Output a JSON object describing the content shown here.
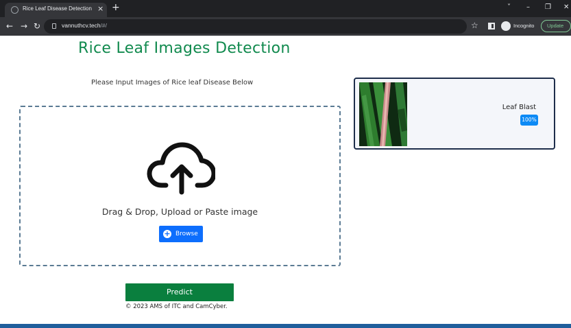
{
  "browser": {
    "tab_title": "Rice Leaf Disease Detection",
    "tab_close": "×",
    "new_tab": "+",
    "url_host": "vannuthcv.tech",
    "url_path": "/#/",
    "incognito_label": "Incognito",
    "update_label": "Update",
    "window_controls": [
      "˅",
      "–",
      "❐",
      "✕"
    ]
  },
  "page": {
    "title": "Rice Leaf Images Detection",
    "instruction": "Please Input Images of Rice leaf Disease Below"
  },
  "dropzone": {
    "text": "Drag & Drop, Upload or Paste image",
    "browse_label": "Browse",
    "icon": "cloud-upload-icon"
  },
  "result": {
    "label": "Leaf Blast",
    "confidence": "100%"
  },
  "actions": {
    "predict_label": "Predict"
  },
  "footer": {
    "text": "© 2023 AMS of ITC and CamCyber."
  },
  "colors": {
    "title_green": "#118a4e",
    "predict_green": "#0a7f3e",
    "browse_blue": "#0d6efd",
    "badge_blue": "#0d8af5",
    "bottom_bar": "#1f5e9c"
  }
}
